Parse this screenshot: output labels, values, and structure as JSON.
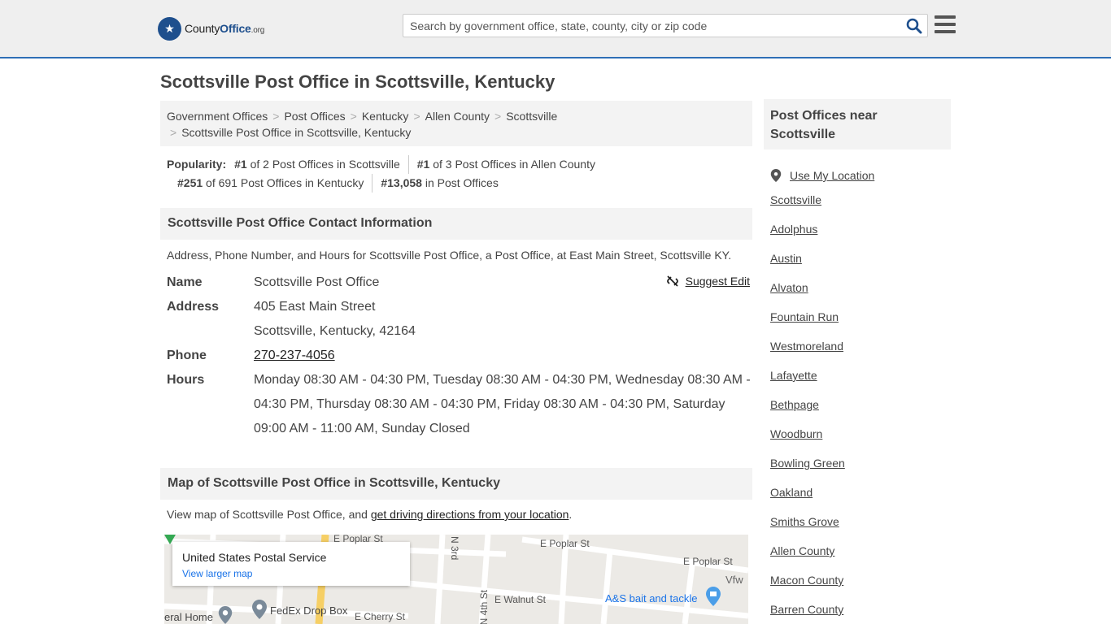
{
  "header": {
    "logo_main": "County",
    "logo_accent": "Office",
    "logo_suffix": ".org",
    "search_placeholder": "Search by government office, state, county, city or zip code"
  },
  "page_title": "Scottsville Post Office in Scottsville, Kentucky",
  "breadcrumb": [
    "Government Offices",
    "Post Offices",
    "Kentucky",
    "Allen County",
    "Scottsville",
    "Scottsville Post Office in Scottsville, Kentucky"
  ],
  "popularity": {
    "label": "Popularity:",
    "items": [
      {
        "rank": "#1",
        "text": "of 2 Post Offices in Scottsville"
      },
      {
        "rank": "#1",
        "text": "of 3 Post Offices in Allen County"
      },
      {
        "rank": "#251",
        "text": "of 691 Post Offices in Kentucky"
      },
      {
        "rank": "#13,058",
        "text": "in Post Offices"
      }
    ]
  },
  "contact": {
    "heading": "Scottsville Post Office Contact Information",
    "description": "Address, Phone Number, and Hours for Scottsville Post Office, a Post Office, at East Main Street, Scottsville KY.",
    "suggest_edit": "Suggest Edit",
    "name_label": "Name",
    "name": "Scottsville Post Office",
    "address_label": "Address",
    "address_line1": "405 East Main Street",
    "address_line2": "Scottsville, Kentucky, 42164",
    "phone_label": "Phone",
    "phone": "270-237-4056",
    "hours_label": "Hours",
    "hours": "Monday 08:30 AM - 04:30 PM, Tuesday 08:30 AM - 04:30 PM, Wednesday 08:30 AM - 04:30 PM, Thursday 08:30 AM - 04:30 PM, Friday 08:30 AM - 04:30 PM, Saturday 09:00 AM - 11:00 AM, Sunday Closed"
  },
  "map": {
    "heading": "Map of Scottsville Post Office in Scottsville, Kentucky",
    "desc_prefix": "View map of Scottsville Post Office, and ",
    "desc_link": "get driving directions from your location",
    "desc_suffix": ".",
    "card_title": "United States Postal Service",
    "card_link": "View larger map",
    "labels": {
      "e_poplar_1": "E Poplar St",
      "e_poplar_2": "E Poplar St",
      "e_poplar_3": "E Poplar St",
      "e_walnut": "E Walnut St",
      "e_cherry": "E Cherry St",
      "n_3rd": "N 3rd",
      "n_4th": "N 4th St",
      "fedex": "FedEx Drop Box",
      "home": "eral Home",
      "bait": "A&S bait and tackle",
      "vfw": "Vfw"
    }
  },
  "sidebar": {
    "heading": "Post Offices near Scottsville",
    "use_location": "Use My Location",
    "items": [
      "Scottsville",
      "Adolphus",
      "Austin",
      "Alvaton",
      "Fountain Run",
      "Westmoreland",
      "Lafayette",
      "Bethpage",
      "Woodburn",
      "Bowling Green",
      "Oakland",
      "Smiths Grove",
      "Allen County",
      "Macon County",
      "Barren County"
    ]
  },
  "colors": {
    "brand": "#1e4f8d",
    "header_bg": "#efefef",
    "header_border": "#2e6fb6",
    "panel_bg": "#f3f3f3",
    "map_link": "#1a73e8"
  }
}
